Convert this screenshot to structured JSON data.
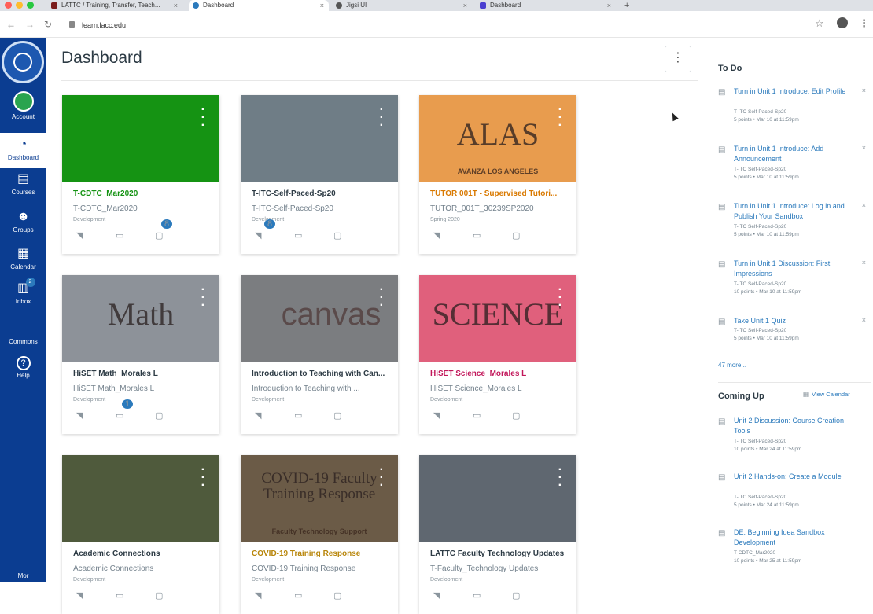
{
  "browser": {
    "tabs": [
      {
        "label": "LATTC / Training, Transfer, Teach...",
        "active": false
      },
      {
        "label": "Dashboard",
        "active": true
      },
      {
        "label": "Jigsi UI",
        "active": false
      },
      {
        "label": "Dashboard",
        "active": false
      }
    ],
    "url": "learn.lacc.edu"
  },
  "nav": {
    "items": [
      {
        "label": "Account"
      },
      {
        "label": "Dashboard"
      },
      {
        "label": "Courses"
      },
      {
        "label": "Groups"
      },
      {
        "label": "Calendar"
      },
      {
        "label": "Inbox",
        "badge": "2"
      },
      {
        "label": "Commons"
      },
      {
        "label": "Help"
      },
      {
        "label": "Mor"
      }
    ]
  },
  "page": {
    "title": "Dashboard",
    "options_glyph": "⋮"
  },
  "cards": [
    {
      "name": "T-CDTC_Mar2020",
      "code": "T-CDTC_Mar2020",
      "term": "Development",
      "color": "#159313",
      "name_color": "#159313",
      "badge": "8"
    },
    {
      "name": "T-ITC-Self-Paced-Sp20",
      "code": "T-ITC-Self-Paced-Sp20",
      "term": "Development",
      "color": "#6f7d86",
      "name_color": "#2d3b45",
      "badge": "8"
    },
    {
      "name": "TUTOR 001T - Supervised Tutori...",
      "code": "TUTOR_001T_30239SP2020",
      "term": "Spring 2020",
      "color": "#e89c4e",
      "name_color": "#d97900",
      "hero_text": "ALAS",
      "hero_sub": "AVANZA LOS ANGELES"
    },
    {
      "name": "HiSET Math_Morales L",
      "code": "HiSET Math_Morales L",
      "term": "Development",
      "color": "#8d9299",
      "name_color": "#2d3b45",
      "hero_text": "Math",
      "badge": "1"
    },
    {
      "name": "Introduction to Teaching with Can...",
      "code": "Introduction to Teaching with ...",
      "term": "Development",
      "color": "#7b7d80",
      "name_color": "#2d3b45",
      "hero_text": "canvas"
    },
    {
      "name": "HiSET Science_Morales L",
      "code": "HiSET Science_Morales L",
      "term": "Development",
      "color": "#e0607c",
      "name_color": "#c2185b",
      "hero_text": "SCIENCE"
    },
    {
      "name": "Academic Connections",
      "code": "Academic Connections",
      "term": "Development",
      "color": "#4f5a3c",
      "name_color": "#2d3b45"
    },
    {
      "name": "COVID-19 Training Response",
      "code": "COVID-19 Training Response",
      "term": "Development",
      "color": "#6b5b47",
      "name_color": "#b8860b",
      "hero_text": "COVID-19 Faculty Training Response",
      "hero_sub": "Faculty Technology Support"
    },
    {
      "name": "LATTC Faculty Technology Updates",
      "code": "T-Faculty_Technology Updates",
      "term": "Development",
      "color": "#5f6770",
      "name_color": "#2d3b45"
    }
  ],
  "todo": {
    "heading": "To Do",
    "items": [
      {
        "title": "Turn in Unit 1 Introduce: Edit Profile",
        "course": "T-ITC Self-Paced-Sp20",
        "due": "5 points • Mar 10 at 11:59pm"
      },
      {
        "title": "Turn in Unit 1 Introduce: Add Announcement",
        "course": "T-ITC Self-Paced-Sp20",
        "due": "5 points • Mar 10 at 11:59pm"
      },
      {
        "title": "Turn in Unit 1 Introduce: Log in and Publish Your Sandbox",
        "course": "T-ITC Self-Paced-Sp20",
        "due": "5 points • Mar 10 at 11:59pm"
      },
      {
        "title": "Turn in Unit 1 Discussion: First Impressions",
        "course": "T-ITC Self-Paced-Sp20",
        "due": "10 points • Mar 10 at 11:59pm"
      },
      {
        "title": "Take Unit 1 Quiz",
        "course": "T-ITC Self-Paced-Sp20",
        "due": "5 points • Mar 10 at 11:59pm"
      }
    ],
    "more": "47 more..."
  },
  "coming_up": {
    "heading": "Coming Up",
    "view_calendar": "View Calendar",
    "items": [
      {
        "title": "Unit 2 Discussion: Course Creation Tools",
        "course": "T-ITC Self-Paced-Sp20",
        "due": "10 points • Mar 24 at 11:59pm"
      },
      {
        "title": "Unit 2 Hands-on: Create a Module",
        "course": "T-ITC Self-Paced-Sp20",
        "due": "5 points • Mar 24 at 11:59pm"
      },
      {
        "title": "DE: Beginning Idea Sandbox Development",
        "course": "T-CDTC_Mar2020",
        "due": "10 points • Mar 25 at 11:59pm"
      }
    ]
  },
  "colors": {
    "nav_bg": "#0b3d91",
    "link": "#2b7abc",
    "text": "#2d3b45"
  },
  "icons": [
    "announcements-icon",
    "discussions-icon",
    "folder-icon",
    "assignments-icon"
  ]
}
